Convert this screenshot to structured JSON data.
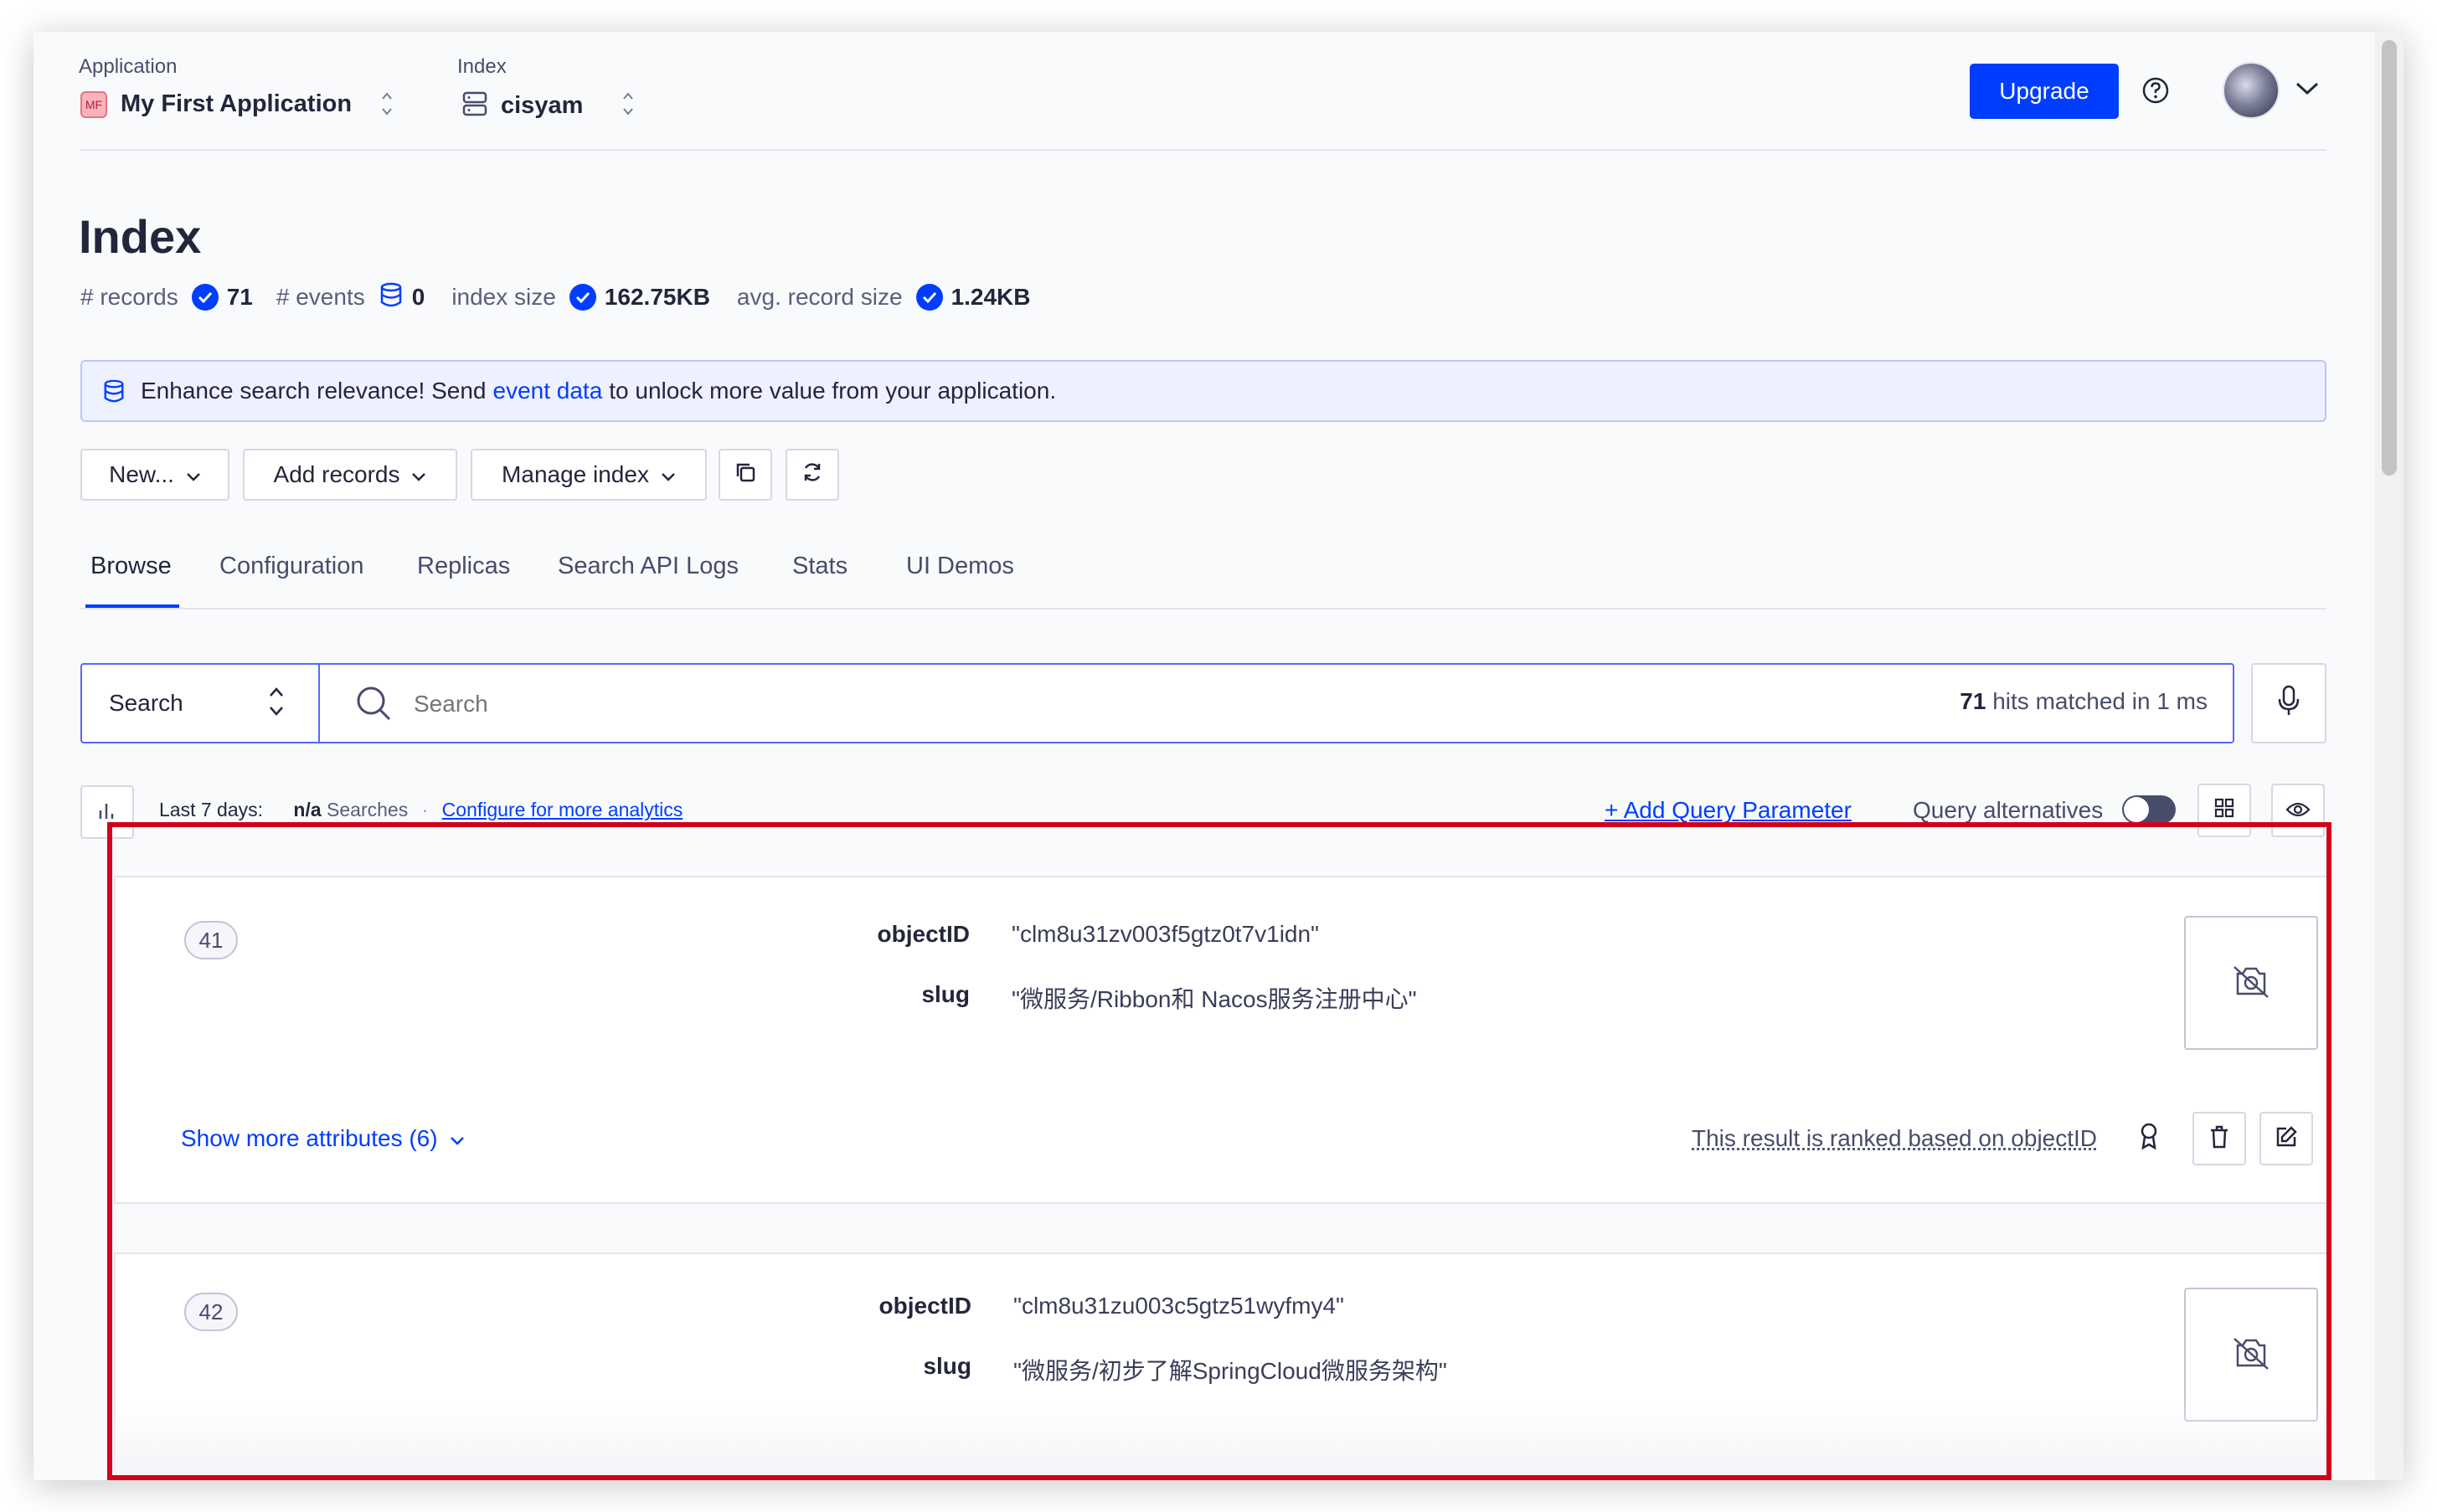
{
  "header": {
    "application_label": "Application",
    "application_abbr": "MF",
    "application_name": "My First Application",
    "index_label": "Index",
    "index_name": "cisyam",
    "upgrade_label": "Upgrade"
  },
  "page": {
    "title": "Index",
    "stats": {
      "records_label": "# records",
      "records_value": "71",
      "events_label": "# events",
      "events_value": "0",
      "index_size_label": "index size",
      "index_size_value": "162.75KB",
      "avg_record_label": "avg. record size",
      "avg_record_value": "1.24KB"
    }
  },
  "banner": {
    "text_before": "Enhance search relevance! Send",
    "link": "event data",
    "text_after": "to unlock more value from your application."
  },
  "toolbar": {
    "new_label": "New...",
    "add_records_label": "Add records",
    "manage_index_label": "Manage index"
  },
  "tabs": [
    {
      "label": "Browse",
      "active": true
    },
    {
      "label": "Configuration"
    },
    {
      "label": "Replicas"
    },
    {
      "label": "Search API Logs"
    },
    {
      "label": "Stats"
    },
    {
      "label": "UI Demos"
    }
  ],
  "search": {
    "mode": "Search",
    "placeholder": "Search",
    "hits_count": "71",
    "hits_text": "hits matched in 1 ms"
  },
  "analytics": {
    "period": "Last 7 days:",
    "searches_value": "n/a",
    "searches_label": "Searches",
    "configure_link": "Configure for more analytics",
    "add_param": "Add Query Parameter",
    "query_alt_label": "Query alternatives"
  },
  "results": [
    {
      "rank": "41",
      "attributes": [
        {
          "key": "objectID",
          "value": "\"clm8u31zv003f5gtz0t7v1idn\""
        },
        {
          "key": "slug",
          "value": "\"微服务/Ribbon和 Nacos服务注册中心\""
        }
      ],
      "show_more": "Show more attributes (6)",
      "ranking_note": "This result is ranked based on objectID"
    },
    {
      "rank": "42",
      "attributes": [
        {
          "key": "objectID",
          "value": "\"clm8u31zu003c5gtz51wyfmy4\""
        },
        {
          "key": "slug",
          "value": "\"微服务/初步了解SpringCloud微服务架构\""
        }
      ]
    }
  ],
  "colors": {
    "primary": "#003dff",
    "highlight_box": "#d0021b"
  }
}
